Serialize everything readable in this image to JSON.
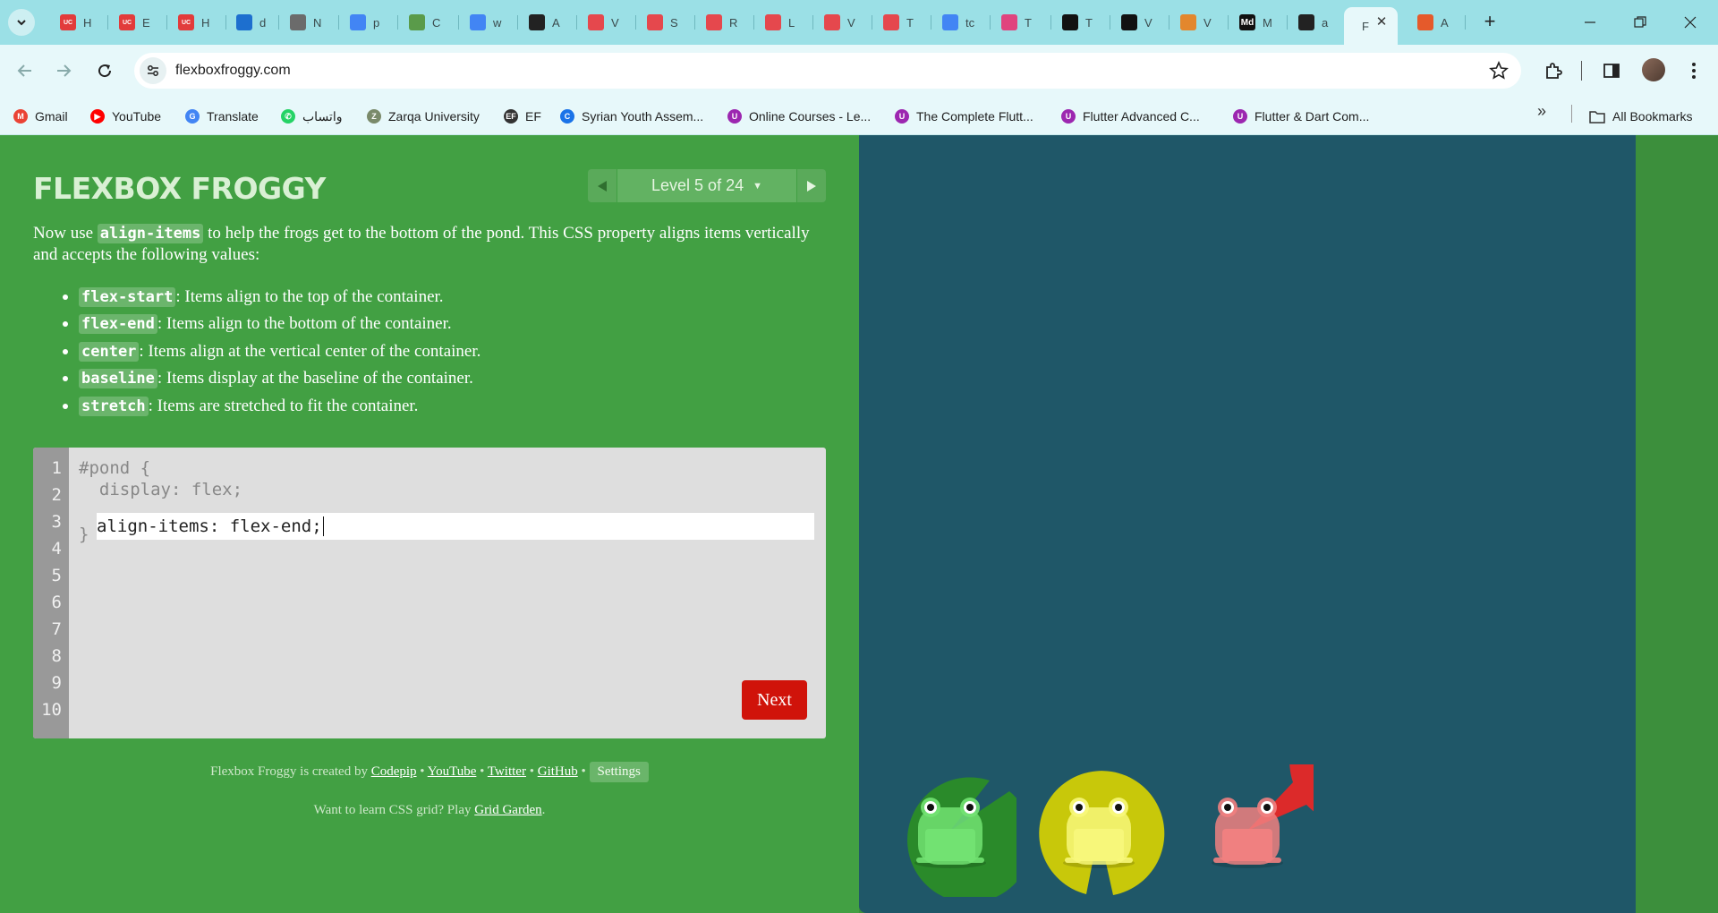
{
  "browser": {
    "tabs": [
      {
        "label": "H",
        "icon": "uc",
        "color": "#e23b3b"
      },
      {
        "label": "E",
        "icon": "uc",
        "color": "#e23b3b"
      },
      {
        "label": "H",
        "icon": "uc",
        "color": "#e23b3b"
      },
      {
        "label": "d",
        "icon": "onedrive",
        "color": "#1d6fcf"
      },
      {
        "label": "N",
        "icon": "openai",
        "color": "#6b6b6b"
      },
      {
        "label": "p",
        "icon": "google",
        "color": "#4285f4"
      },
      {
        "label": "C",
        "icon": "android",
        "color": "#5a9b4a"
      },
      {
        "label": "w",
        "icon": "google",
        "color": "#4285f4"
      },
      {
        "label": "A",
        "icon": "github",
        "color": "#222222"
      },
      {
        "label": "V",
        "icon": "figma",
        "color": "#e5484d"
      },
      {
        "label": "S",
        "icon": "figma",
        "color": "#e5484d"
      },
      {
        "label": "R",
        "icon": "figma",
        "color": "#e5484d"
      },
      {
        "label": "L",
        "icon": "figma",
        "color": "#e5484d"
      },
      {
        "label": "V",
        "icon": "figma",
        "color": "#e5484d"
      },
      {
        "label": "T",
        "icon": "figma",
        "color": "#e5484d"
      },
      {
        "label": "tc",
        "icon": "google",
        "color": "#4285f4"
      },
      {
        "label": "T",
        "icon": "clickup",
        "color": "#e0447e"
      },
      {
        "label": "T",
        "icon": "u",
        "color": "#111111"
      },
      {
        "label": "V",
        "icon": "u",
        "color": "#111111"
      },
      {
        "label": "V",
        "icon": "slides",
        "color": "#e3872d"
      },
      {
        "label": "M",
        "icon": "md",
        "color": "#111111"
      },
      {
        "label": "a",
        "icon": "github",
        "color": "#222222"
      },
      {
        "label": "F",
        "icon": "none",
        "color": "#42a043"
      },
      {
        "label": "A",
        "icon": "star",
        "color": "#e55a2b"
      }
    ],
    "url": "flexboxfroggy.com",
    "bookmarks": [
      {
        "label": "Gmail",
        "color": "#ea4335",
        "glyph": "M"
      },
      {
        "label": "YouTube",
        "color": "#ff0000",
        "glyph": "▶"
      },
      {
        "label": "Translate",
        "color": "#4285f4",
        "glyph": "G"
      },
      {
        "label": "واتساب",
        "color": "#25d366",
        "glyph": "✆"
      },
      {
        "label": "Zarqa University",
        "color": "#7a8a6a",
        "glyph": "Z"
      },
      {
        "label": "EF",
        "color": "#333333",
        "glyph": "EF"
      },
      {
        "label": "Syrian Youth Assem...",
        "color": "#1a73e8",
        "glyph": "C"
      },
      {
        "label": "Online Courses - Le...",
        "color": "#9c27b0",
        "glyph": "U"
      },
      {
        "label": "The Complete Flutt...",
        "color": "#9c27b0",
        "glyph": "U"
      },
      {
        "label": "Flutter Advanced C...",
        "color": "#9c27b0",
        "glyph": "U"
      },
      {
        "label": "Flutter & Dart Com...",
        "color": "#9c27b0",
        "glyph": "U"
      }
    ],
    "all_bookmarks": "All Bookmarks"
  },
  "game": {
    "title": "FLEXBOX FROGGY",
    "level": "Level 5 of 24",
    "intro_before": "Now use ",
    "intro_keyword": "align-items",
    "intro_after": " to help the frogs get to the bottom of the pond. This CSS property aligns items vertically and accepts the following values:",
    "values": [
      {
        "key": "flex-start",
        "desc": ": Items align to the top of the container."
      },
      {
        "key": "flex-end",
        "desc": ": Items align to the bottom of the container."
      },
      {
        "key": "center",
        "desc": ": Items align at the vertical center of the container."
      },
      {
        "key": "baseline",
        "desc": ": Items display at the baseline of the container."
      },
      {
        "key": "stretch",
        "desc": ": Items are stretched to fit the container."
      }
    ],
    "code": {
      "line_numbers": [
        "1",
        "2",
        "3",
        "4",
        "5",
        "6",
        "7",
        "8",
        "9",
        "10"
      ],
      "line1": "#pond {",
      "line2": "  display: flex;",
      "input_value": "align-items: flex-end;",
      "line4": "}"
    },
    "next_label": "Next",
    "credits": {
      "prefix": "Flexbox Froggy is created by ",
      "codepip": "Codepip",
      "youtube": "YouTube",
      "twitter": "Twitter",
      "github": "GitHub",
      "sep": " • ",
      "settings": "Settings"
    },
    "learn": {
      "prefix": "Want to learn CSS grid? Play ",
      "link": "Grid Garden",
      "suffix": "."
    },
    "frogs": [
      {
        "color": "green",
        "pad": "#2a8a2a",
        "body": "#72e272"
      },
      {
        "color": "yellow",
        "pad": "#c8c80a",
        "body": "#f7f77a"
      },
      {
        "color": "red",
        "pad": "#dc2a2a",
        "body": "#f08080"
      }
    ]
  }
}
